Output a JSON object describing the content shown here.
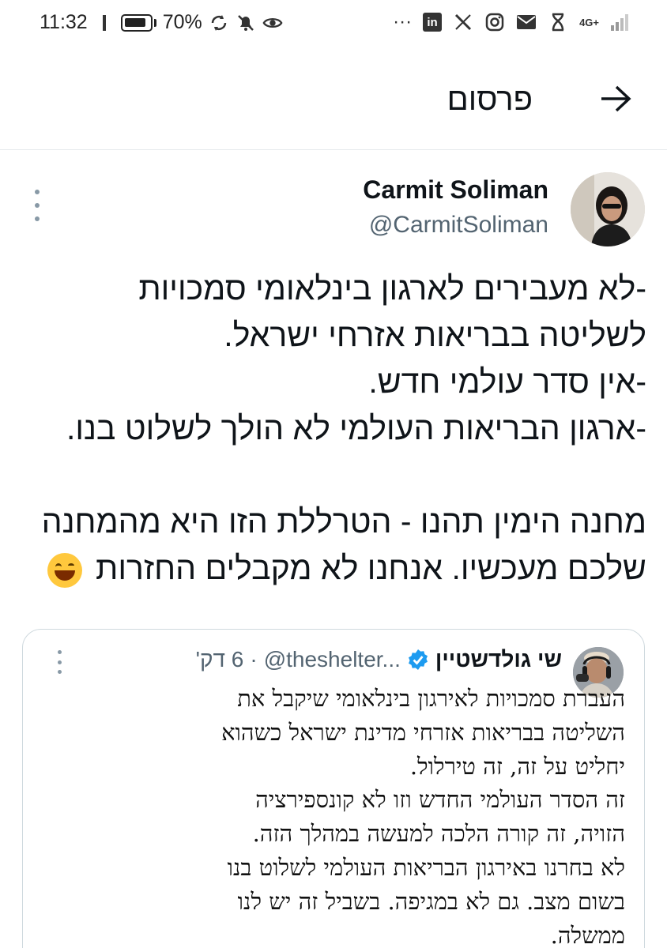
{
  "status_bar": {
    "time": "11:32",
    "battery": "70%",
    "network": "4G+",
    "more": "···"
  },
  "header": {
    "title": "פרסום"
  },
  "tweet": {
    "author_name": "Carmit Soliman",
    "author_handle": "@CarmitSoliman",
    "lines": [
      "-לא מעבירים לארגון בינלאומי סמכויות",
      "לשליטה בבריאות אזרחי ישראל.",
      "-אין סדר עולמי חדש.",
      "-ארגון הבריאות העולמי לא הולך לשלוט בנו.",
      "",
      "מחנה הימין תהנו - הטרללת הזו היא מהמחנה",
      "שלכם מעכשיו. אנחנו לא מקבלים החזרות"
    ]
  },
  "quote": {
    "author_name": "שי גולדשטיין",
    "handle": "@theshelter...",
    "time": "6 דק'",
    "separator": "·",
    "lines": [
      "העברת סמכויות לאירגון בינלאומי שיקבל את",
      "השליטה בבריאות אזרחי מדינת ישראל כשהוא",
      "יחליט על זה, זה טירלול.",
      "זה הסדר העולמי החדש וזו לא קונספירציה",
      "הזויה, זה קורה הלכה למעשה במהלך הזה.",
      "לא בחרנו באירגון הבריאות העולמי לשלוט בנו",
      "בשום מצב. גם לא במגיפה. בשביל זה יש לנו",
      "ממשלה."
    ]
  },
  "colors": {
    "text": "#0f1419",
    "secondary": "#536471",
    "verified": "#1d9bf0",
    "border": "#cfd9de"
  }
}
